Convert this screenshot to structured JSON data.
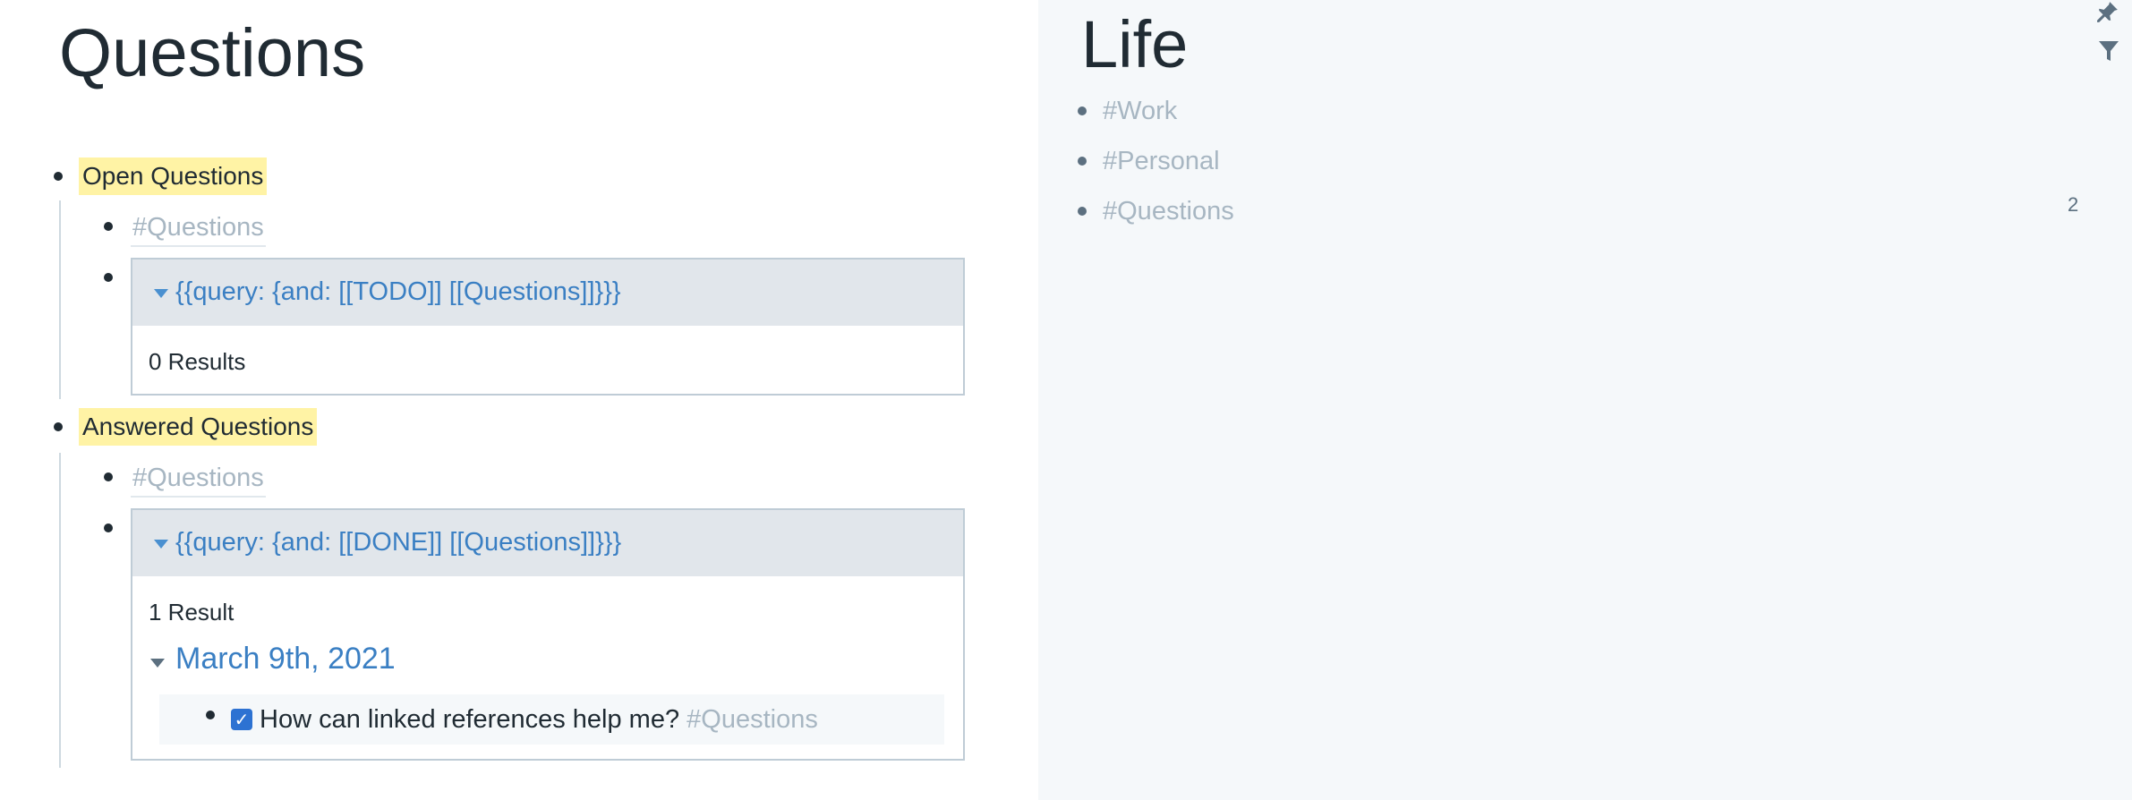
{
  "main": {
    "title": "Questions",
    "sections": [
      {
        "heading": "Open Questions",
        "tag": "#Questions",
        "query": "{{query:  {and: [[TODO]] [[Questions]]}}}",
        "results_label": "0 Results"
      },
      {
        "heading": "Answered Questions",
        "tag": "#Questions",
        "query": "{{query:  {and: [[DONE]] [[Questions]]}}}",
        "results_label": "1 Result",
        "result_group": {
          "date": "March 9th, 2021",
          "item_text": "How can linked references help me?",
          "item_tag": "#Questions",
          "item_checked": true
        }
      }
    ]
  },
  "sidebar": {
    "title": "Life",
    "items": [
      {
        "label": "#Work"
      },
      {
        "label": "#Personal"
      },
      {
        "label": "#Questions",
        "count": "2"
      }
    ],
    "icons": [
      "pin-icon",
      "filter-icon"
    ]
  }
}
